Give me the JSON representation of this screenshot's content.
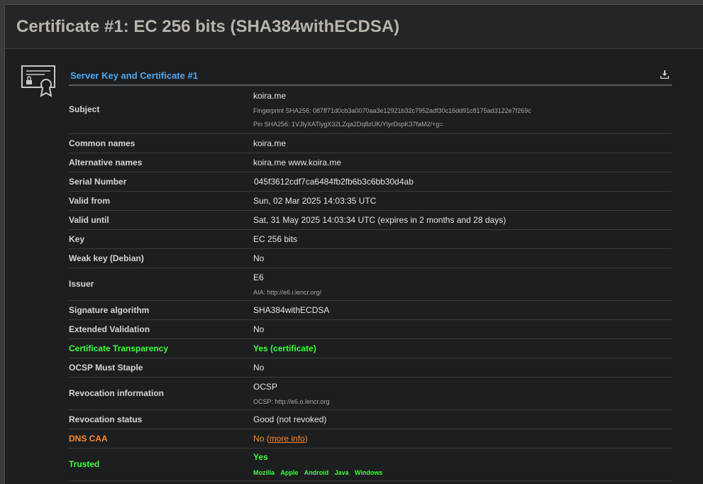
{
  "page": {
    "title": "Certificate #1: EC 256 bits (SHA384withECDSA)"
  },
  "section": {
    "title": "Server Key and Certificate #1"
  },
  "rows": {
    "subject": {
      "label": "Subject",
      "value": "koira.me",
      "fingerprint": "Fingerprint SHA256: 087ff71d0cb3a0070aa3e12921b32c7952adf30c16dd91c8175ad3122e7f269c",
      "pin": "Pin SHA256: 1VJlyXATlygX32LZqa2Dq8zUK/YlyrDspK37faM2/+g="
    },
    "common_names": {
      "label": "Common names",
      "value": "koira.me"
    },
    "alt_names": {
      "label": "Alternative names",
      "value": "koira.me www.koira.me"
    },
    "serial": {
      "label": "Serial Number",
      "value": "045f3612cdf7ca6484fb2fb6b3c6bb30d4ab"
    },
    "valid_from": {
      "label": "Valid from",
      "value": "Sun, 02 Mar 2025 14:03:35 UTC"
    },
    "valid_until": {
      "label": "Valid until",
      "value": "Sat, 31 May 2025 14:03:34 UTC (expires in 2 months and 28 days)"
    },
    "key": {
      "label": "Key",
      "value": "EC 256 bits"
    },
    "weak_key": {
      "label": "Weak key (Debian)",
      "value": "No"
    },
    "issuer": {
      "label": "Issuer",
      "value": "E6",
      "aia": "AIA: http://e6.i.lencr.org/"
    },
    "sig_alg": {
      "label": "Signature algorithm",
      "value": "SHA384withECDSA"
    },
    "ev": {
      "label": "Extended Validation",
      "value": "No"
    },
    "ct": {
      "label": "Certificate Transparency",
      "value": "Yes (certificate)"
    },
    "must_staple": {
      "label": "OCSP Must Staple",
      "value": "No"
    },
    "revocation_info": {
      "label": "Revocation information",
      "value": "OCSP",
      "ocsp": "OCSP: http://e6.o.lencr.org"
    },
    "revocation_status": {
      "label": "Revocation status",
      "value": "Good (not revoked)"
    },
    "dns_caa": {
      "label": "DNS CAA",
      "value": "No",
      "link_open": "(",
      "link": "more info",
      "link_close": ")"
    },
    "trusted": {
      "label": "Trusted",
      "value": "Yes",
      "stores": [
        "Mozilla",
        "Apple",
        "Android",
        "Java",
        "Windows"
      ]
    }
  },
  "colors": {
    "accent_blue": "#4fa8f0",
    "good_green": "#3dff3d",
    "warn_orange": "#ff8a2a"
  },
  "icons": {
    "certificate": "certificate-icon",
    "download": "download-icon"
  }
}
